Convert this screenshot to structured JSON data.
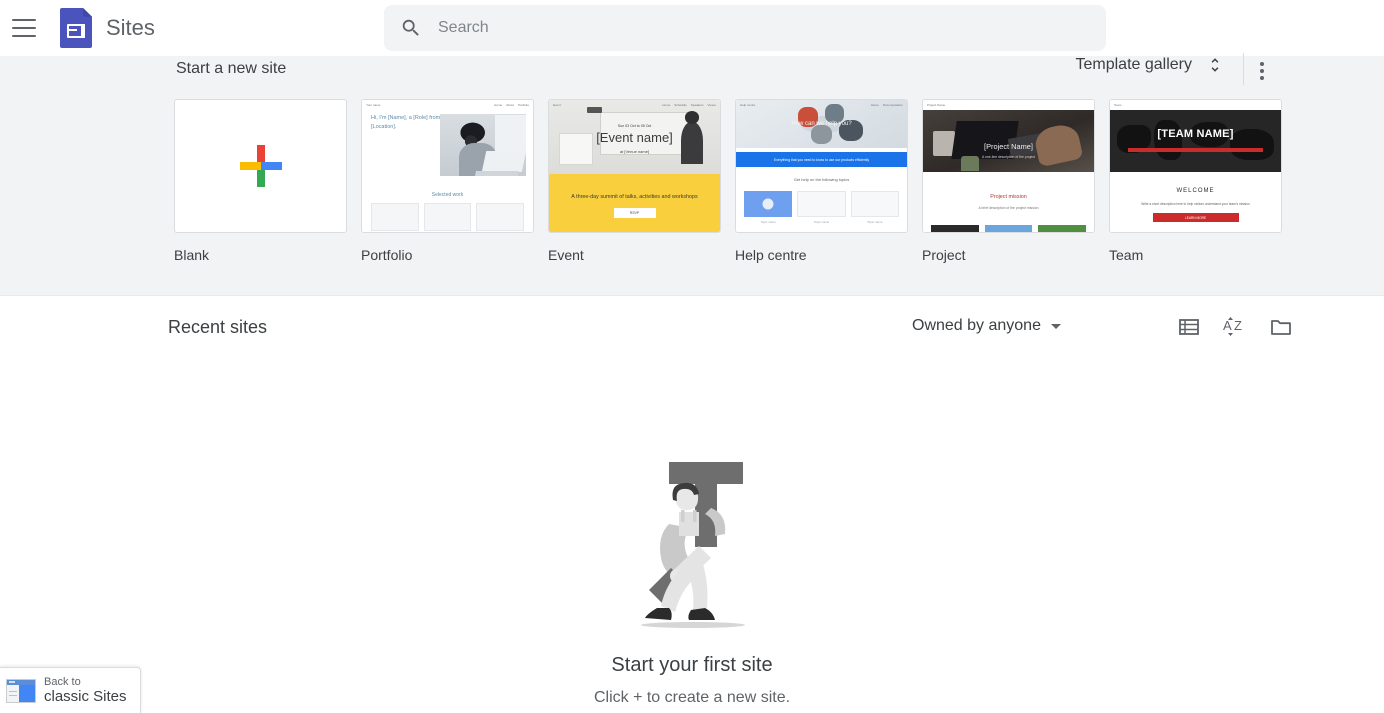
{
  "header": {
    "menu_icon": "hamburger-menu-icon",
    "logo_icon": "google-sites-logo",
    "app_title": "Sites",
    "search": {
      "icon": "search-icon",
      "placeholder": "Search",
      "value": ""
    }
  },
  "template_band": {
    "section_title": "Start a new site",
    "gallery_label": "Template gallery",
    "gallery_toggle_icon": "unfold-more-chevron-icon",
    "more_menu_icon": "more-vert-icon",
    "templates": [
      {
        "label": "Blank",
        "thumb": "blank-plus-thumbnail"
      },
      {
        "label": "Portfolio",
        "thumb": "portfolio-thumbnail",
        "preview": {
          "site_name": "Your name",
          "nav": [
            "Home",
            "About",
            "Portfolio"
          ],
          "headline": "Hi, I'm [Name], a [Role] from [Location].",
          "section": "Selected work"
        }
      },
      {
        "label": "Event",
        "thumb": "event-thumbnail",
        "preview": {
          "site_name": "Event",
          "nav": [
            "Home",
            "Schedule",
            "Speakers",
            "Venue"
          ],
          "eyebrow": "Sun 03 Oct to 05 Oct",
          "title": "[Event name]",
          "subtitle": "at [Venue name]",
          "banner": "A three-day summit of talks, activities and workshops",
          "button": "RSVP"
        }
      },
      {
        "label": "Help centre",
        "thumb": "help-centre-thumbnail",
        "preview": {
          "site_name": "Help centre",
          "nav": [
            "Home",
            "Documentation"
          ],
          "headline": "How can we help you?",
          "banner": "Everything that you need to know to use our products efficiently",
          "section": "Get help on the following topics",
          "cards": [
            "Topic name",
            "Topic name",
            "Topic name"
          ]
        }
      },
      {
        "label": "Project",
        "thumb": "project-thumbnail",
        "preview": {
          "site_name": "Project Name",
          "title": "[Project Name]",
          "subtitle": "A one-line description of the project",
          "section": "Project mission",
          "body": "A brief description of the project mission"
        }
      },
      {
        "label": "Team",
        "thumb": "team-thumbnail",
        "preview": {
          "site_name": "Team",
          "title": "[TEAM NAME]",
          "section": "WELCOME",
          "body": "Write a short description here to help visitors understand your team's mission",
          "button": "LEARN MORE"
        }
      }
    ]
  },
  "recent": {
    "title": "Recent sites",
    "owner_filter_label": "Owned by anyone",
    "owner_filter_icon": "dropdown-caret-icon",
    "view_icons": [
      {
        "name": "list-view-icon"
      },
      {
        "name": "sort-az-icon"
      },
      {
        "name": "folder-icon"
      }
    ]
  },
  "empty_state": {
    "illustration": "person-carrying-letter-t-illustration",
    "title": "Start your first site",
    "subtitle": "Click + to create a new site."
  },
  "classic_sites": {
    "icon": "classic-sites-window-icon",
    "line1": "Back to",
    "line2": "classic Sites"
  },
  "colors": {
    "band_background": "#f1f3f4",
    "logo_purple": "#4b53bc",
    "google_red": "#ea4335",
    "google_blue": "#4285f4",
    "google_yellow": "#fbbc04",
    "google_green": "#34a853",
    "event_yellow": "#f9cf3d",
    "team_red": "#cc2b2b",
    "text_primary": "#3c4043",
    "text_secondary": "#5f6368"
  }
}
